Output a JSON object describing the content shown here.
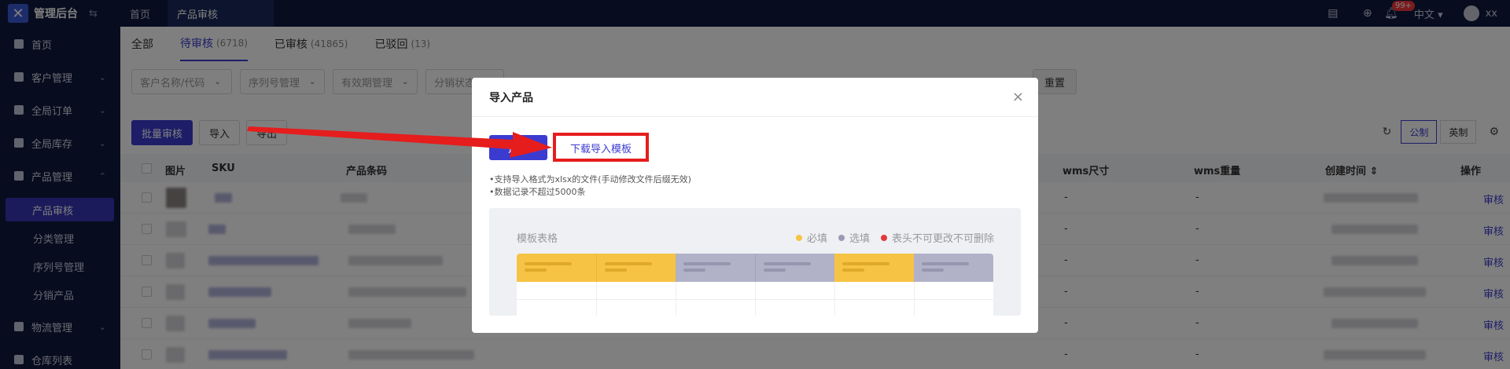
{
  "topbar": {
    "brand_title": "管理后台",
    "collapse_icon": "⇆",
    "tabs": [
      "首页",
      "产品审核"
    ],
    "notification_badge": "99+",
    "language": "中文",
    "username": "xx"
  },
  "sidebar": {
    "items": [
      {
        "label": "首页"
      },
      {
        "label": "客户管理"
      },
      {
        "label": "全局订单"
      },
      {
        "label": "全局库存"
      },
      {
        "label": "产品管理"
      },
      {
        "label": "物流管理"
      },
      {
        "label": "仓库列表"
      }
    ],
    "sub_items": [
      {
        "label": "产品审核"
      },
      {
        "label": "分类管理"
      },
      {
        "label": "序列号管理"
      },
      {
        "label": "分销产品"
      }
    ]
  },
  "status_tabs": [
    {
      "label": "全部",
      "count": ""
    },
    {
      "label": "待审核",
      "count": "(6718)"
    },
    {
      "label": "已审核",
      "count": "(41865)"
    },
    {
      "label": "已驳回",
      "count": "(13)"
    }
  ],
  "filters": {
    "customer": "客户名称/代码",
    "serial": "序列号管理",
    "expiry": "有效期管理",
    "distribution": "分销状态",
    "reset": "重置"
  },
  "toolbar": {
    "batch_audit": "批量审核",
    "import": "导入",
    "export": "导出",
    "metric": "公制",
    "imperial": "英制"
  },
  "table": {
    "headers": {
      "image": "图片",
      "sku": "SKU",
      "barcode": "产品条码",
      "wms_size": "wms尺寸",
      "wms_weight": "wms重量",
      "created": "创建时间",
      "action": "操作"
    },
    "rows": [
      {
        "wms_size": "-",
        "wms_weight": "-",
        "action": "审核"
      },
      {
        "wms_size": "-",
        "wms_weight": "-",
        "action": "审核"
      },
      {
        "wms_size": "-",
        "wms_weight": "-",
        "action": "审核"
      },
      {
        "wms_size": "-",
        "wms_weight": "-",
        "action": "审核"
      },
      {
        "wms_size": "-",
        "wms_weight": "-",
        "action": "审核"
      },
      {
        "wms_size": "-",
        "wms_weight": "-",
        "action": "审核"
      }
    ]
  },
  "modal": {
    "title": "导入产品",
    "close": "×",
    "choose_button": "选择",
    "download_template": "下载导入模板",
    "note_1": "•支持导入格式为xlsx的文件(手动修改文件后缀无效)",
    "note_2": "•数据记录不超过5000条",
    "template_title": "模板表格",
    "legend": [
      {
        "label": "必填",
        "color": "#f6c344"
      },
      {
        "label": "选填",
        "color": "#9a9ab5"
      },
      {
        "label": "表头不可更改不可删除",
        "color": "#e0393c"
      }
    ],
    "columns": [
      "required",
      "required",
      "optional",
      "optional",
      "required",
      "optional"
    ]
  },
  "colors": {
    "accent": "#3b3bd1",
    "nav_bg": "#0e1a3f",
    "required": "#f6c344",
    "optional": "#b1b1c8",
    "annotation": "#e51d1d"
  }
}
